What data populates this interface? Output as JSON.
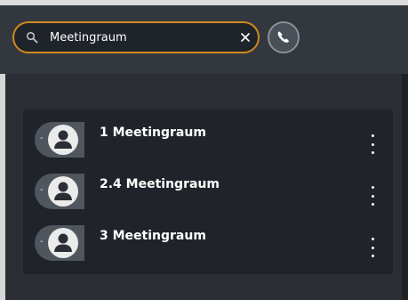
{
  "search": {
    "value": "Meetingraum",
    "search_icon": "search-icon",
    "clear_icon": "close-icon"
  },
  "call_button": {
    "icon": "phone-icon"
  },
  "colors": {
    "accent": "#d18a1c",
    "background": "#2b2f35",
    "panel": "#20242a",
    "avatar": "#50565e"
  },
  "results": [
    {
      "label": "1 Meetingraum",
      "avatar_icon": "person-icon",
      "menu_icon": "more-vertical-icon"
    },
    {
      "label": "2.4 Meetingraum",
      "avatar_icon": "person-icon",
      "menu_icon": "more-vertical-icon"
    },
    {
      "label": "3 Meetingraum",
      "avatar_icon": "person-icon",
      "menu_icon": "more-vertical-icon"
    }
  ]
}
